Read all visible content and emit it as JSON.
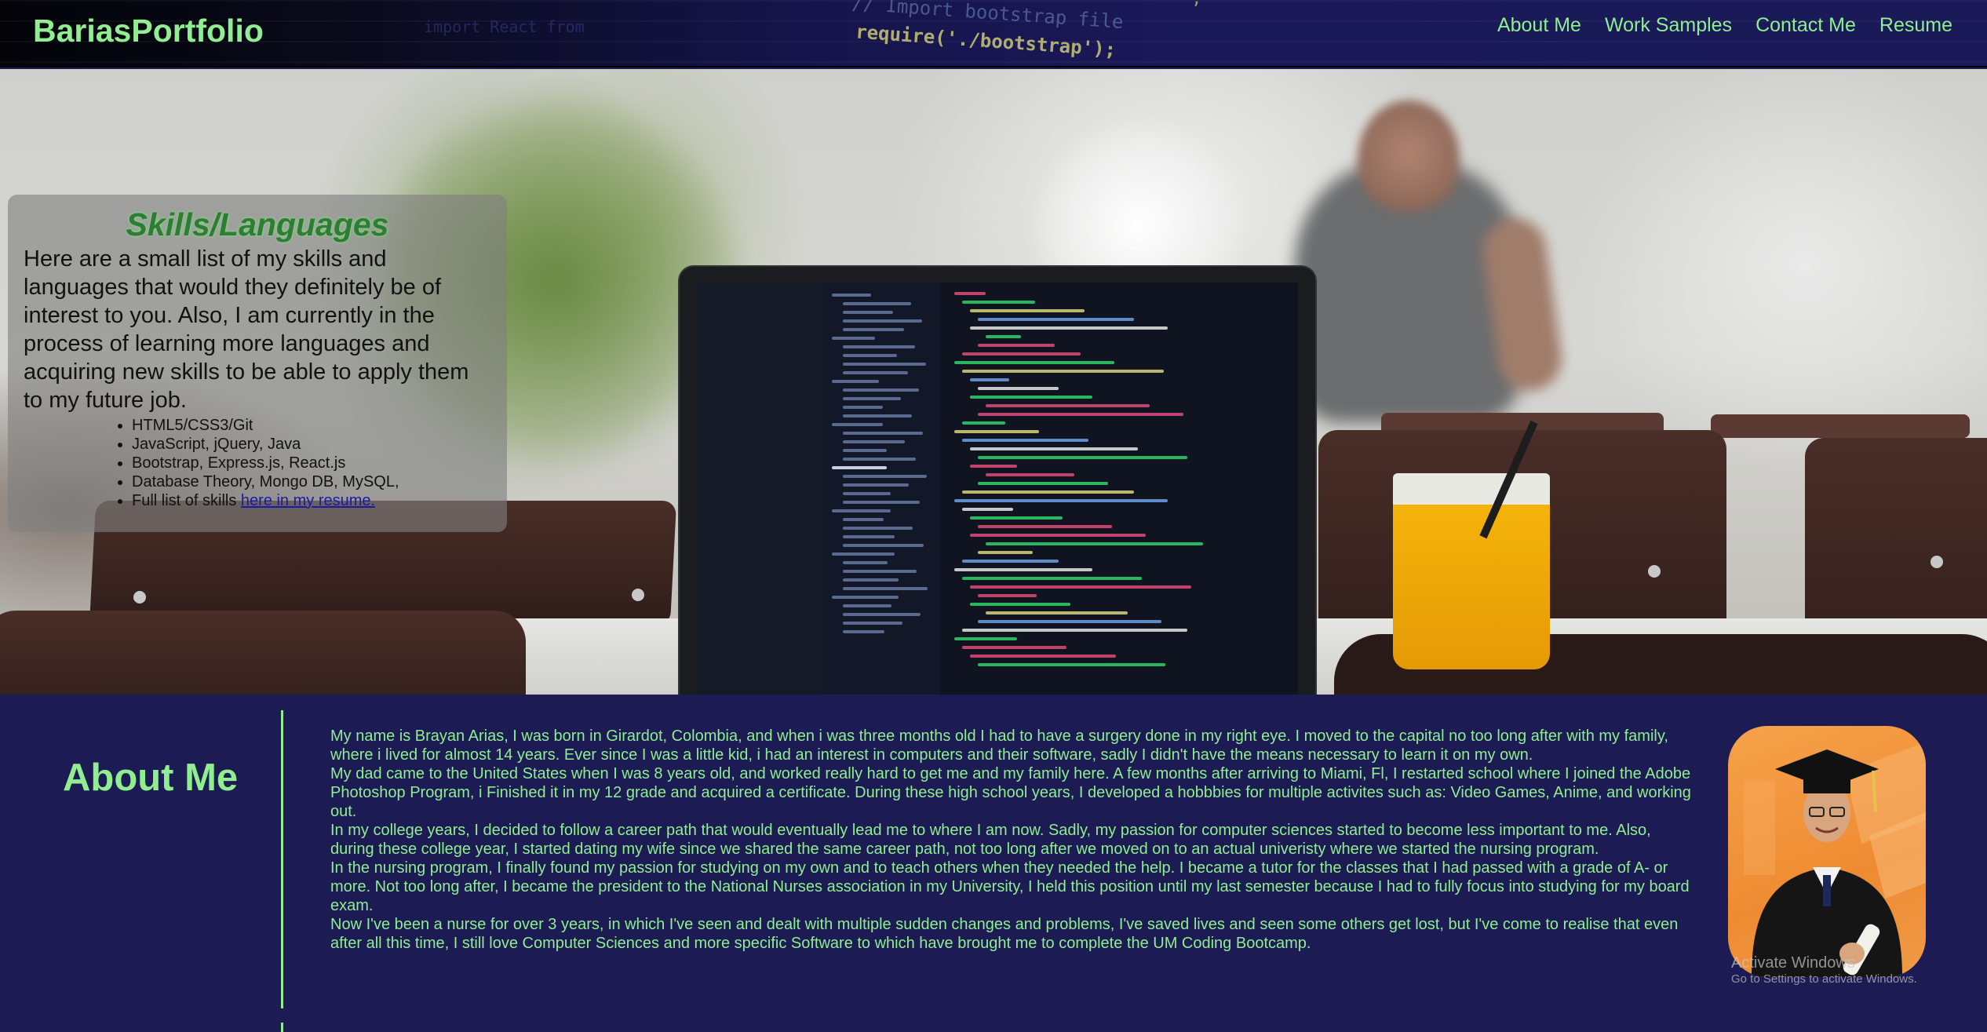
{
  "navbar": {
    "brand": "BariasPortfolio",
    "links": [
      "About Me",
      "Work Samples",
      "Contact Me",
      "Resume"
    ],
    "background_code": [
      "// Import bootstrap file",
      "require('./bootstrap');",
      "',",
      "import React from"
    ]
  },
  "skills": {
    "title": "Skills/Languages",
    "intro": "Here are a small list of my skills and languages that would they definitely be of interest to you. Also, I am currently in the process of learning more languages and acquiring new skills to be able to apply them to my future job.",
    "items": [
      "HTML5/CSS3/Git",
      "JavaScript, jQuery, Java",
      "Bootstrap, Express.js, React.js",
      "Database Theory, Mongo DB, MySQL,"
    ],
    "resume_prefix": "Full list of skills ",
    "resume_link": "here in my resume."
  },
  "about": {
    "heading": "About Me",
    "paragraphs": [
      "My name is Brayan Arias, I was born in Girardot, Colombia, and when i was three months old I had to have a surgery done in my right eye. I moved to the capital no too long after with my family, where i lived for almost 14 years. Ever since I was a little kid, i had an interest in computers and their software, sadly I didn't have the means necessary to learn it on my own.",
      "My dad came to the United States when I was 8 years old, and worked really hard to get me and my family here. A few months after arriving to Miami, Fl, I restarted school where I joined the Adobe Photoshop Program, i Finished it in my 12 grade and acquired a certificate. During these high school years, I developed a hobbbies for multiple activites such as: Video Games, Anime, and working out.",
      "In my college years, I decided to follow a career path that would eventually lead me to where I am now. Sadly, my passion for computer sciences started to become less important to me. Also, during these college year, I started dating my wife since we shared the same career path, not too long after we moved on to an actual univeristy where we started the nursing program.",
      "In the nursing program, I finally found my passion for studying on my own and to teach others when they needed the help. I became a tutor for the classes that I had passed with a grade of A- or more. Not too long after, I became the president to the National Nurses association in my University, I held this position until my last semester because I had to fully focus into studying for my board exam.",
      "Now I've been a nurse for over 3 years, in which I've seen and dealt with multiple sudden changes and problems, I've saved lives and seen some others get lost, but I've come to realise that even after all this time, I still love Computer Sciences and more specific Software to which have brought me to complete the UM Coding Bootcamp."
    ]
  },
  "watermark": {
    "title": "Activate Windows",
    "subtitle": "Go to Settings to activate Windows."
  },
  "colors": {
    "accent_green": "#90ee90",
    "page_navy": "#1c1b53",
    "link_blue": "#1a1aa8"
  }
}
